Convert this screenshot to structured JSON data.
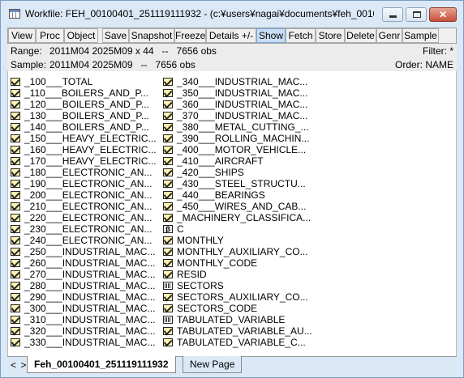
{
  "window": {
    "title": "Workfile: FEH_00100401_251119111932 - (c:¥users¥nagai¥documents¥feh_00100...",
    "close_glyph": "✕"
  },
  "toolbar": {
    "buttons": [
      "View",
      "Proc",
      "Object",
      "Save",
      "Snapshot",
      "Freeze",
      "Details +/-",
      "Show",
      "Fetch",
      "Store",
      "Delete",
      "Genr",
      "Sample"
    ],
    "active": "Show"
  },
  "info": {
    "range_label": "Range:",
    "range_value": "2011M04 2025M09 x 44   --   7656 obs",
    "filter_label": "Filter: *",
    "sample_label": "Sample:",
    "sample_value": "2011M04 2025M09   --   7656 obs",
    "order_label": "Order: NAME"
  },
  "objects": {
    "left": [
      {
        "name": "_100___TOTAL",
        "type": "series"
      },
      {
        "name": "_110___BOILERS_AND_P...",
        "type": "series"
      },
      {
        "name": "_120___BOILERS_AND_P...",
        "type": "series"
      },
      {
        "name": "_130___BOILERS_AND_P...",
        "type": "series"
      },
      {
        "name": "_140___BOILERS_AND_P...",
        "type": "series"
      },
      {
        "name": "_150___HEAVY_ELECTRIC...",
        "type": "series"
      },
      {
        "name": "_160___HEAVY_ELECTRIC...",
        "type": "series"
      },
      {
        "name": "_170___HEAVY_ELECTRIC...",
        "type": "series"
      },
      {
        "name": "_180___ELECTRONIC_AN...",
        "type": "series"
      },
      {
        "name": "_190___ELECTRONIC_AN...",
        "type": "series"
      },
      {
        "name": "_200___ELECTRONIC_AN...",
        "type": "series"
      },
      {
        "name": "_210___ELECTRONIC_AN...",
        "type": "series"
      },
      {
        "name": "_220___ELECTRONIC_AN...",
        "type": "series"
      },
      {
        "name": "_230___ELECTRONIC_AN...",
        "type": "series"
      },
      {
        "name": "_240___ELECTRONIC_AN...",
        "type": "series"
      },
      {
        "name": "_250___INDUSTRIAL_MAC...",
        "type": "series"
      },
      {
        "name": "_260___INDUSTRIAL_MAC...",
        "type": "series"
      },
      {
        "name": "_270___INDUSTRIAL_MAC...",
        "type": "series"
      },
      {
        "name": "_280___INDUSTRIAL_MAC...",
        "type": "series"
      },
      {
        "name": "_290___INDUSTRIAL_MAC...",
        "type": "series"
      },
      {
        "name": "_300___INDUSTRIAL_MAC...",
        "type": "series"
      },
      {
        "name": "_310___INDUSTRIAL_MAC...",
        "type": "series"
      },
      {
        "name": "_320___INDUSTRIAL_MAC...",
        "type": "series"
      },
      {
        "name": "_330___INDUSTRIAL_MAC...",
        "type": "series"
      }
    ],
    "right": [
      {
        "name": "_340___INDUSTRIAL_MAC...",
        "type": "series"
      },
      {
        "name": "_350___INDUSTRIAL_MAC...",
        "type": "series"
      },
      {
        "name": "_360___INDUSTRIAL_MAC...",
        "type": "series"
      },
      {
        "name": "_370___INDUSTRIAL_MAC...",
        "type": "series"
      },
      {
        "name": "_380___METAL_CUTTING_...",
        "type": "series"
      },
      {
        "name": "_390___ROLLING_MACHIN...",
        "type": "series"
      },
      {
        "name": "_400___MOTOR_VEHICLE...",
        "type": "series"
      },
      {
        "name": "_410___AIRCRAFT",
        "type": "series"
      },
      {
        "name": "_420___SHIPS",
        "type": "series"
      },
      {
        "name": "_430___STEEL_STRUCTU...",
        "type": "series"
      },
      {
        "name": "_440___BEARINGS",
        "type": "series"
      },
      {
        "name": "_450___WIRES_AND_CAB...",
        "type": "series"
      },
      {
        "name": "_MACHINERY_CLASSIFICA...",
        "type": "series"
      },
      {
        "name": "C",
        "type": "scalar",
        "glyph": "β"
      },
      {
        "name": "MONTHLY",
        "type": "series"
      },
      {
        "name": "MONTHLY_AUXILIARY_CO...",
        "type": "series"
      },
      {
        "name": "MONTHLY_CODE",
        "type": "series"
      },
      {
        "name": "RESID",
        "type": "series"
      },
      {
        "name": "SECTORS",
        "type": "alpha"
      },
      {
        "name": "SECTORS_AUXILIARY_CO...",
        "type": "series"
      },
      {
        "name": "SECTORS_CODE",
        "type": "series"
      },
      {
        "name": "TABULATED_VARIABLE",
        "type": "alpha"
      },
      {
        "name": "TABULATED_VARIABLE_AU...",
        "type": "series"
      },
      {
        "name": "TABULATED_VARIABLE_C...",
        "type": "series"
      }
    ]
  },
  "tabs": {
    "arrows": "< >",
    "active": "Feh_00100401_251119111932",
    "new_page": "New Page"
  }
}
